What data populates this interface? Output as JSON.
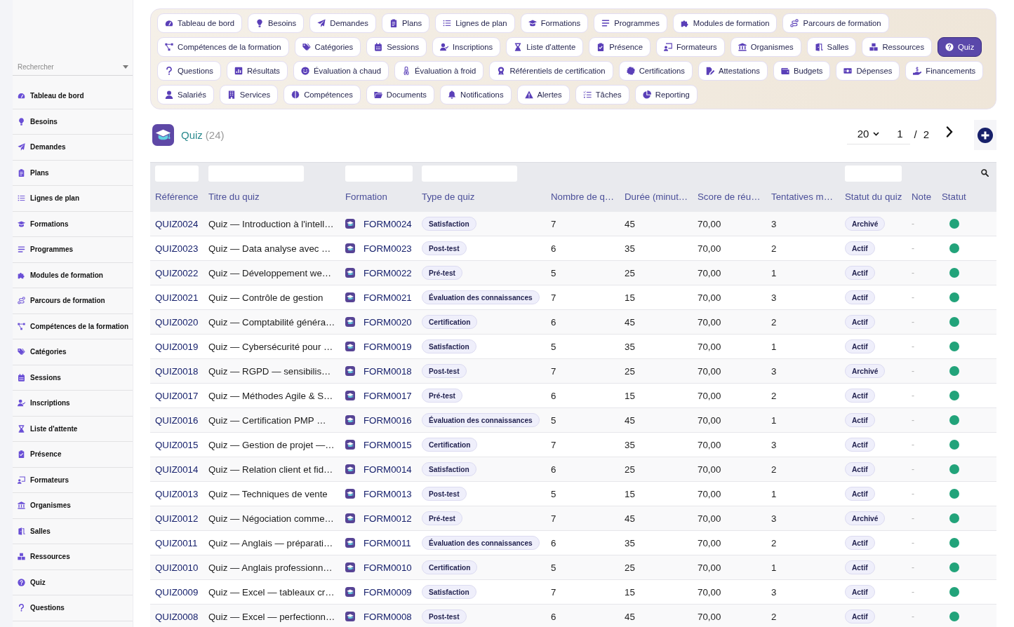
{
  "sidebar": {
    "search": {
      "placeholder": "Rechercher"
    },
    "items": [
      {
        "label": "Tableau de bord"
      },
      {
        "label": "Besoins"
      },
      {
        "label": "Demandes"
      },
      {
        "label": "Plans"
      },
      {
        "label": "Lignes de plan"
      },
      {
        "label": "Formations"
      },
      {
        "label": "Programmes"
      },
      {
        "label": "Modules de formation"
      },
      {
        "label": "Parcours de formation"
      },
      {
        "label": "Compétences de la formation"
      },
      {
        "label": "Catégories"
      },
      {
        "label": "Sessions"
      },
      {
        "label": "Inscriptions"
      },
      {
        "label": "Liste d'attente"
      },
      {
        "label": "Présence"
      },
      {
        "label": "Formateurs"
      },
      {
        "label": "Organismes"
      },
      {
        "label": "Salles"
      },
      {
        "label": "Ressources"
      },
      {
        "label": "Quiz"
      },
      {
        "label": "Questions"
      }
    ]
  },
  "tabs": [
    {
      "label": "Tableau de bord",
      "selected": false
    },
    {
      "label": "Besoins",
      "selected": false
    },
    {
      "label": "Demandes",
      "selected": false
    },
    {
      "label": "Plans",
      "selected": false
    },
    {
      "label": "Lignes de plan",
      "selected": false
    },
    {
      "label": "Formations",
      "selected": false
    },
    {
      "label": "Programmes",
      "selected": false
    },
    {
      "label": "Modules de formation",
      "selected": false
    },
    {
      "label": "Parcours de formation",
      "selected": false
    },
    {
      "label": "Compétences de la formation",
      "selected": false
    },
    {
      "label": "Catégories",
      "selected": false
    },
    {
      "label": "Sessions",
      "selected": false
    },
    {
      "label": "Inscriptions",
      "selected": false
    },
    {
      "label": "Liste d'attente",
      "selected": false
    },
    {
      "label": "Présence",
      "selected": false
    },
    {
      "label": "Formateurs",
      "selected": false
    },
    {
      "label": "Organismes",
      "selected": false
    },
    {
      "label": "Salles",
      "selected": false
    },
    {
      "label": "Ressources",
      "selected": false
    },
    {
      "label": "Quiz",
      "selected": true
    },
    {
      "label": "Questions",
      "selected": false
    },
    {
      "label": "Résultats",
      "selected": false
    },
    {
      "label": "Évaluation à chaud",
      "selected": false
    },
    {
      "label": "Évaluation à froid",
      "selected": false
    },
    {
      "label": "Référentiels de certification",
      "selected": false
    },
    {
      "label": "Certifications",
      "selected": false
    },
    {
      "label": "Attestations",
      "selected": false
    },
    {
      "label": "Budgets",
      "selected": false
    },
    {
      "label": "Dépenses",
      "selected": false
    },
    {
      "label": "Financements",
      "selected": false
    },
    {
      "label": "Salariés",
      "selected": false
    },
    {
      "label": "Services",
      "selected": false
    },
    {
      "label": "Compétences",
      "selected": false
    },
    {
      "label": "Documents",
      "selected": false
    },
    {
      "label": "Notifications",
      "selected": false
    },
    {
      "label": "Alertes",
      "selected": false
    },
    {
      "label": "Tâches",
      "selected": false
    },
    {
      "label": "Reporting",
      "selected": false
    }
  ],
  "header": {
    "title": "Quiz",
    "count": "(24)"
  },
  "pagination": {
    "page_size": "20",
    "page": "1",
    "separator": "/",
    "total_pages": "2"
  },
  "table": {
    "columns": [
      {
        "label": "Référence",
        "filter": true
      },
      {
        "label": "Titre du quiz",
        "filter": true
      },
      {
        "label": "Formation",
        "filter": true
      },
      {
        "label": "Type de quiz",
        "filter": true
      },
      {
        "label": "Nombre de q…",
        "filter": false
      },
      {
        "label": "Durée (minut…",
        "filter": false
      },
      {
        "label": "Score de réu…",
        "filter": false
      },
      {
        "label": "Tentatives m…",
        "filter": false
      },
      {
        "label": "Statut du quiz",
        "filter": true
      },
      {
        "label": "Note",
        "filter": false
      },
      {
        "label": "Statut",
        "filter": false
      }
    ],
    "rows": [
      {
        "reference": "QUIZ0024",
        "title": "Quiz — Introduction à l'intell…",
        "formation": "FORM0024",
        "type": "Satisfaction",
        "questions": "7",
        "duration": "45",
        "score": "70,00",
        "attempts": "3",
        "status": "Archivé",
        "note": "-",
        "active": true
      },
      {
        "reference": "QUIZ0023",
        "title": "Quiz — Data analyse avec …",
        "formation": "FORM0023",
        "type": "Post-test",
        "questions": "6",
        "duration": "35",
        "score": "70,00",
        "attempts": "2",
        "status": "Actif",
        "note": "-",
        "active": true
      },
      {
        "reference": "QUIZ0022",
        "title": "Quiz — Développement we…",
        "formation": "FORM0022",
        "type": "Pré-test",
        "questions": "5",
        "duration": "25",
        "score": "70,00",
        "attempts": "1",
        "status": "Actif",
        "note": "-",
        "active": true
      },
      {
        "reference": "QUIZ0021",
        "title": "Quiz — Contrôle de gestion",
        "formation": "FORM0021",
        "type": "Évaluation des connaissances",
        "questions": "7",
        "duration": "15",
        "score": "70,00",
        "attempts": "3",
        "status": "Actif",
        "note": "-",
        "active": true
      },
      {
        "reference": "QUIZ0020",
        "title": "Quiz — Comptabilité généra…",
        "formation": "FORM0020",
        "type": "Certification",
        "questions": "6",
        "duration": "45",
        "score": "70,00",
        "attempts": "2",
        "status": "Actif",
        "note": "-",
        "active": true
      },
      {
        "reference": "QUIZ0019",
        "title": "Quiz — Cybersécurité pour …",
        "formation": "FORM0019",
        "type": "Satisfaction",
        "questions": "5",
        "duration": "35",
        "score": "70,00",
        "attempts": "1",
        "status": "Actif",
        "note": "-",
        "active": true
      },
      {
        "reference": "QUIZ0018",
        "title": "Quiz — RGPD — sensibilis…",
        "formation": "FORM0018",
        "type": "Post-test",
        "questions": "7",
        "duration": "25",
        "score": "70,00",
        "attempts": "3",
        "status": "Archivé",
        "note": "-",
        "active": true
      },
      {
        "reference": "QUIZ0017",
        "title": "Quiz — Méthodes Agile & S…",
        "formation": "FORM0017",
        "type": "Pré-test",
        "questions": "6",
        "duration": "15",
        "score": "70,00",
        "attempts": "2",
        "status": "Actif",
        "note": "-",
        "active": true
      },
      {
        "reference": "QUIZ0016",
        "title": "Quiz — Certification PMP …",
        "formation": "FORM0016",
        "type": "Évaluation des connaissances",
        "questions": "5",
        "duration": "45",
        "score": "70,00",
        "attempts": "1",
        "status": "Actif",
        "note": "-",
        "active": true
      },
      {
        "reference": "QUIZ0015",
        "title": "Quiz — Gestion de projet —…",
        "formation": "FORM0015",
        "type": "Certification",
        "questions": "7",
        "duration": "35",
        "score": "70,00",
        "attempts": "3",
        "status": "Actif",
        "note": "-",
        "active": true
      },
      {
        "reference": "QUIZ0014",
        "title": "Quiz — Relation client et fid…",
        "formation": "FORM0014",
        "type": "Satisfaction",
        "questions": "6",
        "duration": "25",
        "score": "70,00",
        "attempts": "2",
        "status": "Actif",
        "note": "-",
        "active": true
      },
      {
        "reference": "QUIZ0013",
        "title": "Quiz — Techniques de vente",
        "formation": "FORM0013",
        "type": "Post-test",
        "questions": "5",
        "duration": "15",
        "score": "70,00",
        "attempts": "1",
        "status": "Actif",
        "note": "-",
        "active": true
      },
      {
        "reference": "QUIZ0012",
        "title": "Quiz — Négociation comme…",
        "formation": "FORM0012",
        "type": "Pré-test",
        "questions": "7",
        "duration": "45",
        "score": "70,00",
        "attempts": "3",
        "status": "Archivé",
        "note": "-",
        "active": true
      },
      {
        "reference": "QUIZ0011",
        "title": "Quiz — Anglais — préparati…",
        "formation": "FORM0011",
        "type": "Évaluation des connaissances",
        "questions": "6",
        "duration": "35",
        "score": "70,00",
        "attempts": "2",
        "status": "Actif",
        "note": "-",
        "active": true
      },
      {
        "reference": "QUIZ0010",
        "title": "Quiz — Anglais professionn…",
        "formation": "FORM0010",
        "type": "Certification",
        "questions": "5",
        "duration": "25",
        "score": "70,00",
        "attempts": "1",
        "status": "Actif",
        "note": "-",
        "active": true
      },
      {
        "reference": "QUIZ0009",
        "title": "Quiz — Excel — tableaux cr…",
        "formation": "FORM0009",
        "type": "Satisfaction",
        "questions": "7",
        "duration": "15",
        "score": "70,00",
        "attempts": "3",
        "status": "Actif",
        "note": "-",
        "active": true
      },
      {
        "reference": "QUIZ0008",
        "title": "Quiz — Excel — perfectionn…",
        "formation": "FORM0008",
        "type": "Post-test",
        "questions": "6",
        "duration": "45",
        "score": "70,00",
        "attempts": "2",
        "status": "Actif",
        "note": "-",
        "active": true
      }
    ]
  }
}
